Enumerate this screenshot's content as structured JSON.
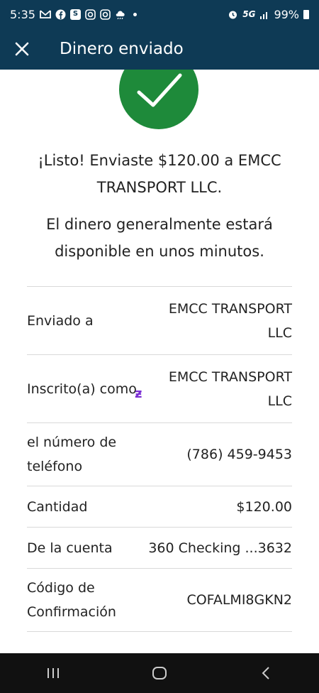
{
  "status": {
    "time": "5:35",
    "network": "5G",
    "battery": "99%"
  },
  "header": {
    "title": "Dinero enviado"
  },
  "message": {
    "line1": "¡Listo! Enviaste $120.00 a EMCC TRANSPORT LLC.",
    "line2": "El dinero generalmente estará disponible en unos minutos."
  },
  "details": [
    {
      "label": "Enviado a",
      "value": "EMCC TRANSPORT LLC"
    },
    {
      "label": "Inscrito(a) como",
      "value": "EMCC TRANSPORT LLC"
    },
    {
      "label": "el número de teléfono",
      "value": "(786) 459-9453"
    },
    {
      "label": "Cantidad",
      "value": "$120.00"
    },
    {
      "label": "De la cuenta",
      "value": "360 Checking ...3632"
    },
    {
      "label": "Código de Confirmación",
      "value": "COFALMI8GKN2"
    }
  ],
  "icons": {
    "close": "close-icon",
    "success": "check-icon",
    "zelle": "zelle-icon",
    "nav_recent": "recent-apps-icon",
    "nav_home": "home-icon",
    "nav_back": "back-icon"
  },
  "colors": {
    "header_bg": "#0e3a55",
    "success_green": "#1e8a3a",
    "zelle_purple": "#7b2fd4"
  }
}
